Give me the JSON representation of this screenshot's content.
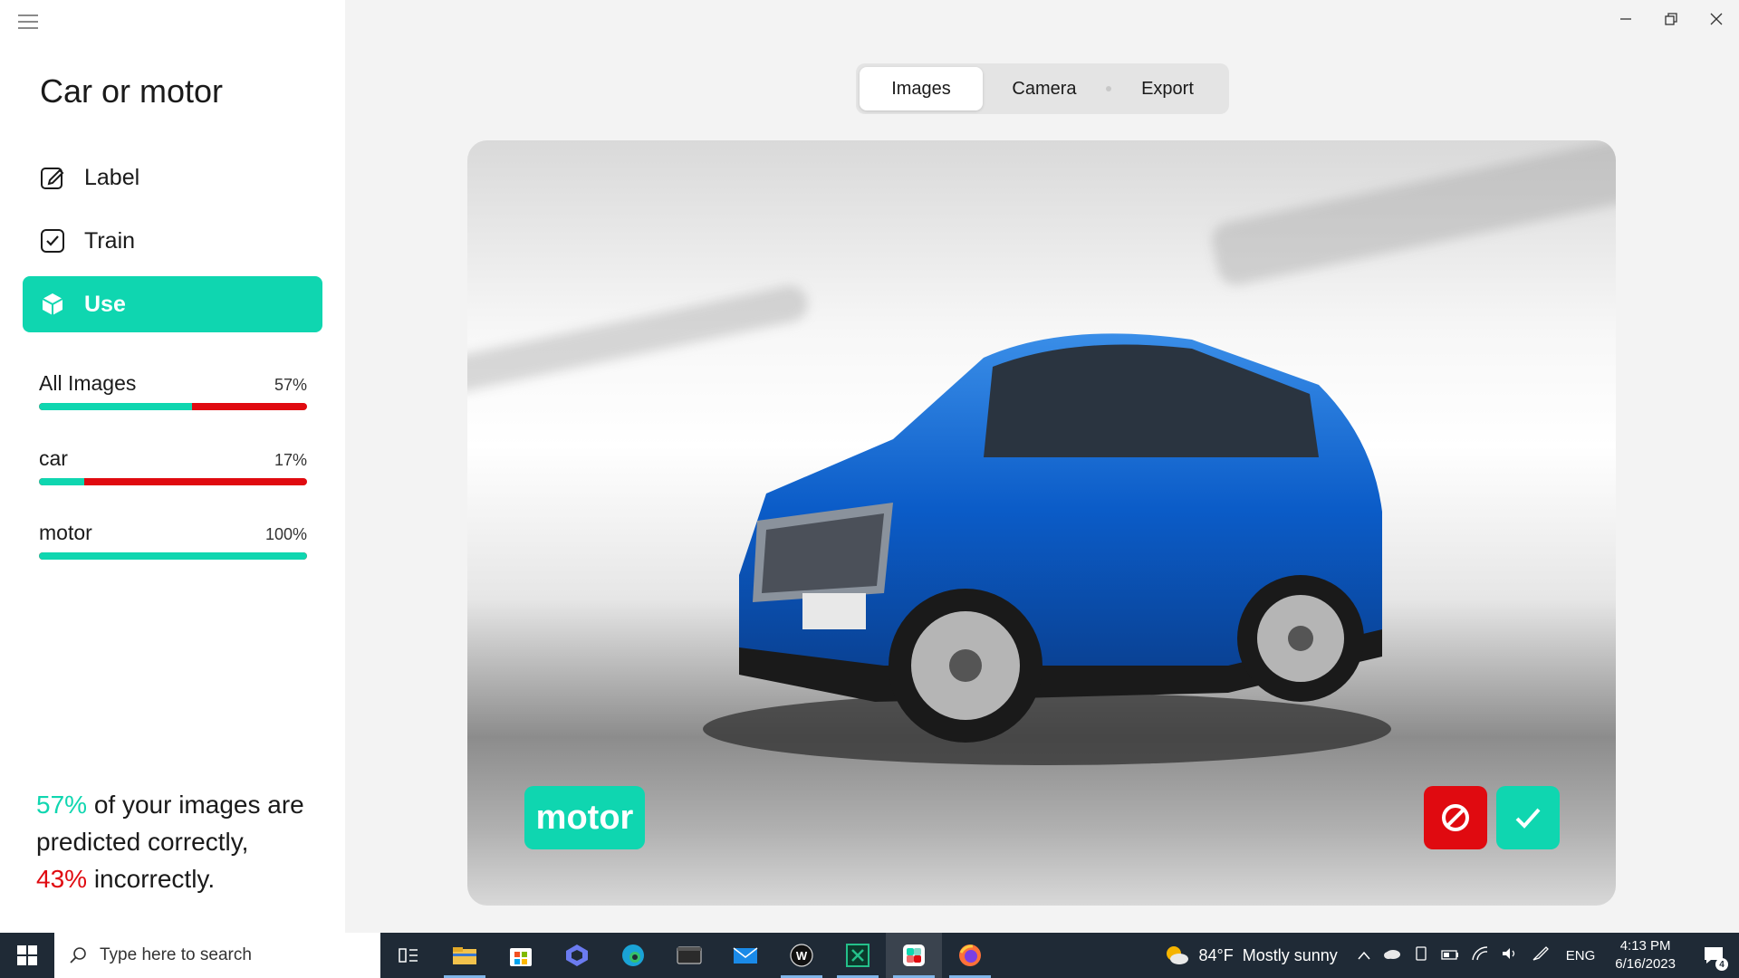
{
  "app": {
    "title": "Car or motor"
  },
  "nav": [
    {
      "label": "Label",
      "icon": "pencil-icon",
      "active": false
    },
    {
      "label": "Train",
      "icon": "checkbox-icon",
      "active": false
    },
    {
      "label": "Use",
      "icon": "cube-icon",
      "active": true
    }
  ],
  "stats": [
    {
      "name": "All Images",
      "percent_label": "57%",
      "correct_fraction": 0.57
    },
    {
      "name": "car",
      "percent_label": "17%",
      "correct_fraction": 0.17
    },
    {
      "name": "motor",
      "percent_label": "100%",
      "correct_fraction": 1.0
    }
  ],
  "summary": {
    "correct_pct": "57%",
    "correct_text": " of your images are predicted correctly,",
    "incorrect_pct": "43%",
    "incorrect_text": " incorrectly."
  },
  "tabs": [
    {
      "label": "Images",
      "selected": true
    },
    {
      "label": "Camera",
      "selected": false
    },
    {
      "label": "Export",
      "selected": false
    }
  ],
  "prediction": {
    "label": "motor"
  },
  "colors": {
    "accent": "#0fd6b0",
    "error": "#e00a10",
    "taskbar": "#1f2a36"
  },
  "taskbar": {
    "search_placeholder": "Type here to search",
    "weather_temp": "84°F",
    "weather_desc": "Mostly sunny",
    "language": "ENG",
    "time": "4:13 PM",
    "date": "6/16/2023",
    "notification_count": "4"
  }
}
